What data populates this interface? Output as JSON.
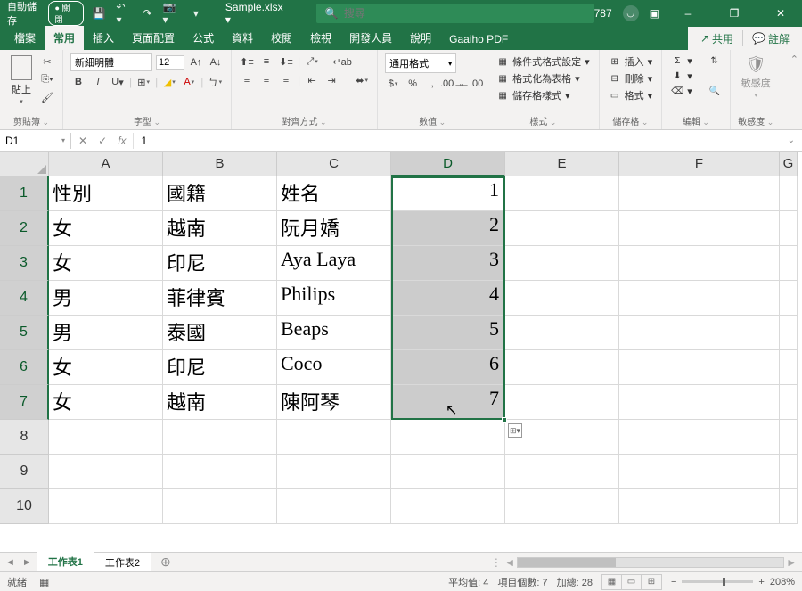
{
  "title_bar": {
    "autosave_label": "自動儲存",
    "autosave_state": "● 關閉",
    "file_name": "Sample.xlsx ▾",
    "search_placeholder": "搜尋",
    "user_name": "787",
    "ribbon_display": "▢"
  },
  "tabs": {
    "items": [
      "檔案",
      "常用",
      "插入",
      "頁面配置",
      "公式",
      "資料",
      "校閱",
      "檢視",
      "開發人員",
      "說明",
      "Gaaiho PDF"
    ],
    "active_index": 1,
    "share": "共用",
    "comments": "註解"
  },
  "ribbon": {
    "clipboard": {
      "paste": "貼上",
      "label": "剪貼簿"
    },
    "font": {
      "name": "新細明體",
      "size": "12",
      "label": "字型"
    },
    "alignment": {
      "wrap": "",
      "label": "對齊方式"
    },
    "number": {
      "format": "通用格式",
      "label": "數值"
    },
    "styles": {
      "cond": "條件式格式設定",
      "table": "格式化為表格",
      "cell": "儲存格樣式",
      "label": "樣式"
    },
    "cells": {
      "insert": "插入",
      "delete": "刪除",
      "format": "格式",
      "label": "儲存格"
    },
    "editing": {
      "label": "編輯"
    },
    "sensitivity": {
      "btn": "敏感度",
      "label": "敏感度"
    }
  },
  "formula_bar": {
    "name_box": "D1",
    "value": "1"
  },
  "columns": [
    "A",
    "B",
    "C",
    "D",
    "E",
    "F",
    "G"
  ],
  "selected_col": 3,
  "rows": [
    {
      "n": 1,
      "A": "性別",
      "B": "國籍",
      "C": "姓名",
      "D": "1"
    },
    {
      "n": 2,
      "A": "女",
      "B": "越南",
      "C": "阮月嬌",
      "D": "2"
    },
    {
      "n": 3,
      "A": "女",
      "B": "印尼",
      "C": "Aya Laya",
      "D": "3"
    },
    {
      "n": 4,
      "A": "男",
      "B": "菲律賓",
      "C": "Philips",
      "D": "4"
    },
    {
      "n": 5,
      "A": "男",
      "B": "泰國",
      "C": "Beaps",
      "D": "5"
    },
    {
      "n": 6,
      "A": "女",
      "B": "印尼",
      "C": "Coco",
      "D": "6"
    },
    {
      "n": 7,
      "A": "女",
      "B": "越南",
      "C": "陳阿琴",
      "D": "7"
    },
    {
      "n": 8,
      "A": "",
      "B": "",
      "C": "",
      "D": ""
    },
    {
      "n": 9,
      "A": "",
      "B": "",
      "C": "",
      "D": ""
    },
    {
      "n": 10,
      "A": "",
      "B": "",
      "C": "",
      "D": ""
    }
  ],
  "sheet_tabs": {
    "items": [
      "工作表1",
      "工作表2"
    ],
    "active_index": 0
  },
  "status_bar": {
    "ready": "就緒",
    "avg": "平均值: 4",
    "count": "項目個數: 7",
    "sum": "加總: 28",
    "zoom": "208%"
  }
}
